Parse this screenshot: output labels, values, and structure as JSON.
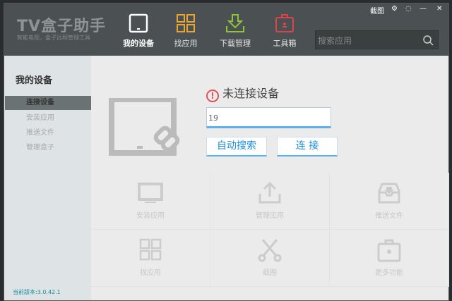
{
  "app": {
    "logo": "TV盒子助手",
    "slogan": "智能电视，盒子远程管理工具"
  },
  "controls": {
    "screenshot": "截图"
  },
  "nav": [
    {
      "label": "我的设备"
    },
    {
      "label": "找应用"
    },
    {
      "label": "下载管理"
    },
    {
      "label": "工具箱"
    }
  ],
  "search": {
    "placeholder": "搜索应用"
  },
  "sidebar": {
    "title": "我的设备",
    "items": [
      {
        "label": "连接设备"
      },
      {
        "label": "安装应用"
      },
      {
        "label": "推送文件"
      },
      {
        "label": "管理盒子"
      }
    ],
    "version": "当前版本:3.0.42.1"
  },
  "main": {
    "status": "未连接设备",
    "ip_value": "19",
    "auto_search": "自动搜索",
    "connect": "连 接"
  },
  "grid": [
    {
      "label": "安装应用"
    },
    {
      "label": "管理应用"
    },
    {
      "label": "推送文件"
    },
    {
      "label": "找应用"
    },
    {
      "label": "截图"
    },
    {
      "label": "更多功能"
    }
  ],
  "colors": {
    "accent": "#1a8fdc",
    "warning": "#e0505a"
  }
}
